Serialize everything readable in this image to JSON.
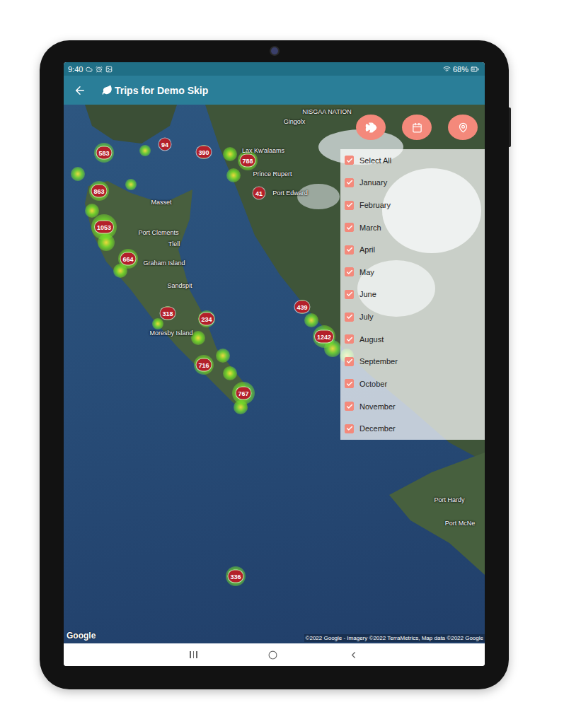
{
  "status_bar": {
    "time": "9:40",
    "battery": "68%"
  },
  "app_bar": {
    "title": "Trips for Demo Skip"
  },
  "map": {
    "clusters": [
      {
        "count": "583"
      },
      {
        "count": "94"
      },
      {
        "count": "390"
      },
      {
        "count": "788"
      },
      {
        "count": "41"
      },
      {
        "count": "863"
      },
      {
        "count": "1053"
      },
      {
        "count": "664"
      },
      {
        "count": "318"
      },
      {
        "count": "234"
      },
      {
        "count": "439"
      },
      {
        "count": "1242"
      },
      {
        "count": "716"
      },
      {
        "count": "767"
      },
      {
        "count": "336"
      }
    ],
    "labels": [
      {
        "text": "NISGAA NATION"
      },
      {
        "text": "Gingolx"
      },
      {
        "text": "Lax Kw'alaams"
      },
      {
        "text": "Prince Rupert"
      },
      {
        "text": "Port Edward"
      },
      {
        "text": "Masset"
      },
      {
        "text": "Port Clements"
      },
      {
        "text": "Tlell"
      },
      {
        "text": "Graham Island"
      },
      {
        "text": "Sandspit"
      },
      {
        "text": "Moresby Island"
      },
      {
        "text": "Port Hardy"
      },
      {
        "text": "Port McNe"
      }
    ],
    "logo": "Google",
    "attribution": "©2022 Google - Imagery ©2022 TerraMetrics, Map data ©2022 Google"
  },
  "month_filter": {
    "items": [
      {
        "label": "Select All",
        "checked": true
      },
      {
        "label": "January",
        "checked": true
      },
      {
        "label": "February",
        "checked": true
      },
      {
        "label": "March",
        "checked": true
      },
      {
        "label": "April",
        "checked": true
      },
      {
        "label": "May",
        "checked": true
      },
      {
        "label": "June",
        "checked": true
      },
      {
        "label": "July",
        "checked": true
      },
      {
        "label": "August",
        "checked": true
      },
      {
        "label": "September",
        "checked": true
      },
      {
        "label": "October",
        "checked": true
      },
      {
        "label": "November",
        "checked": true
      },
      {
        "label": "December",
        "checked": true
      }
    ]
  }
}
